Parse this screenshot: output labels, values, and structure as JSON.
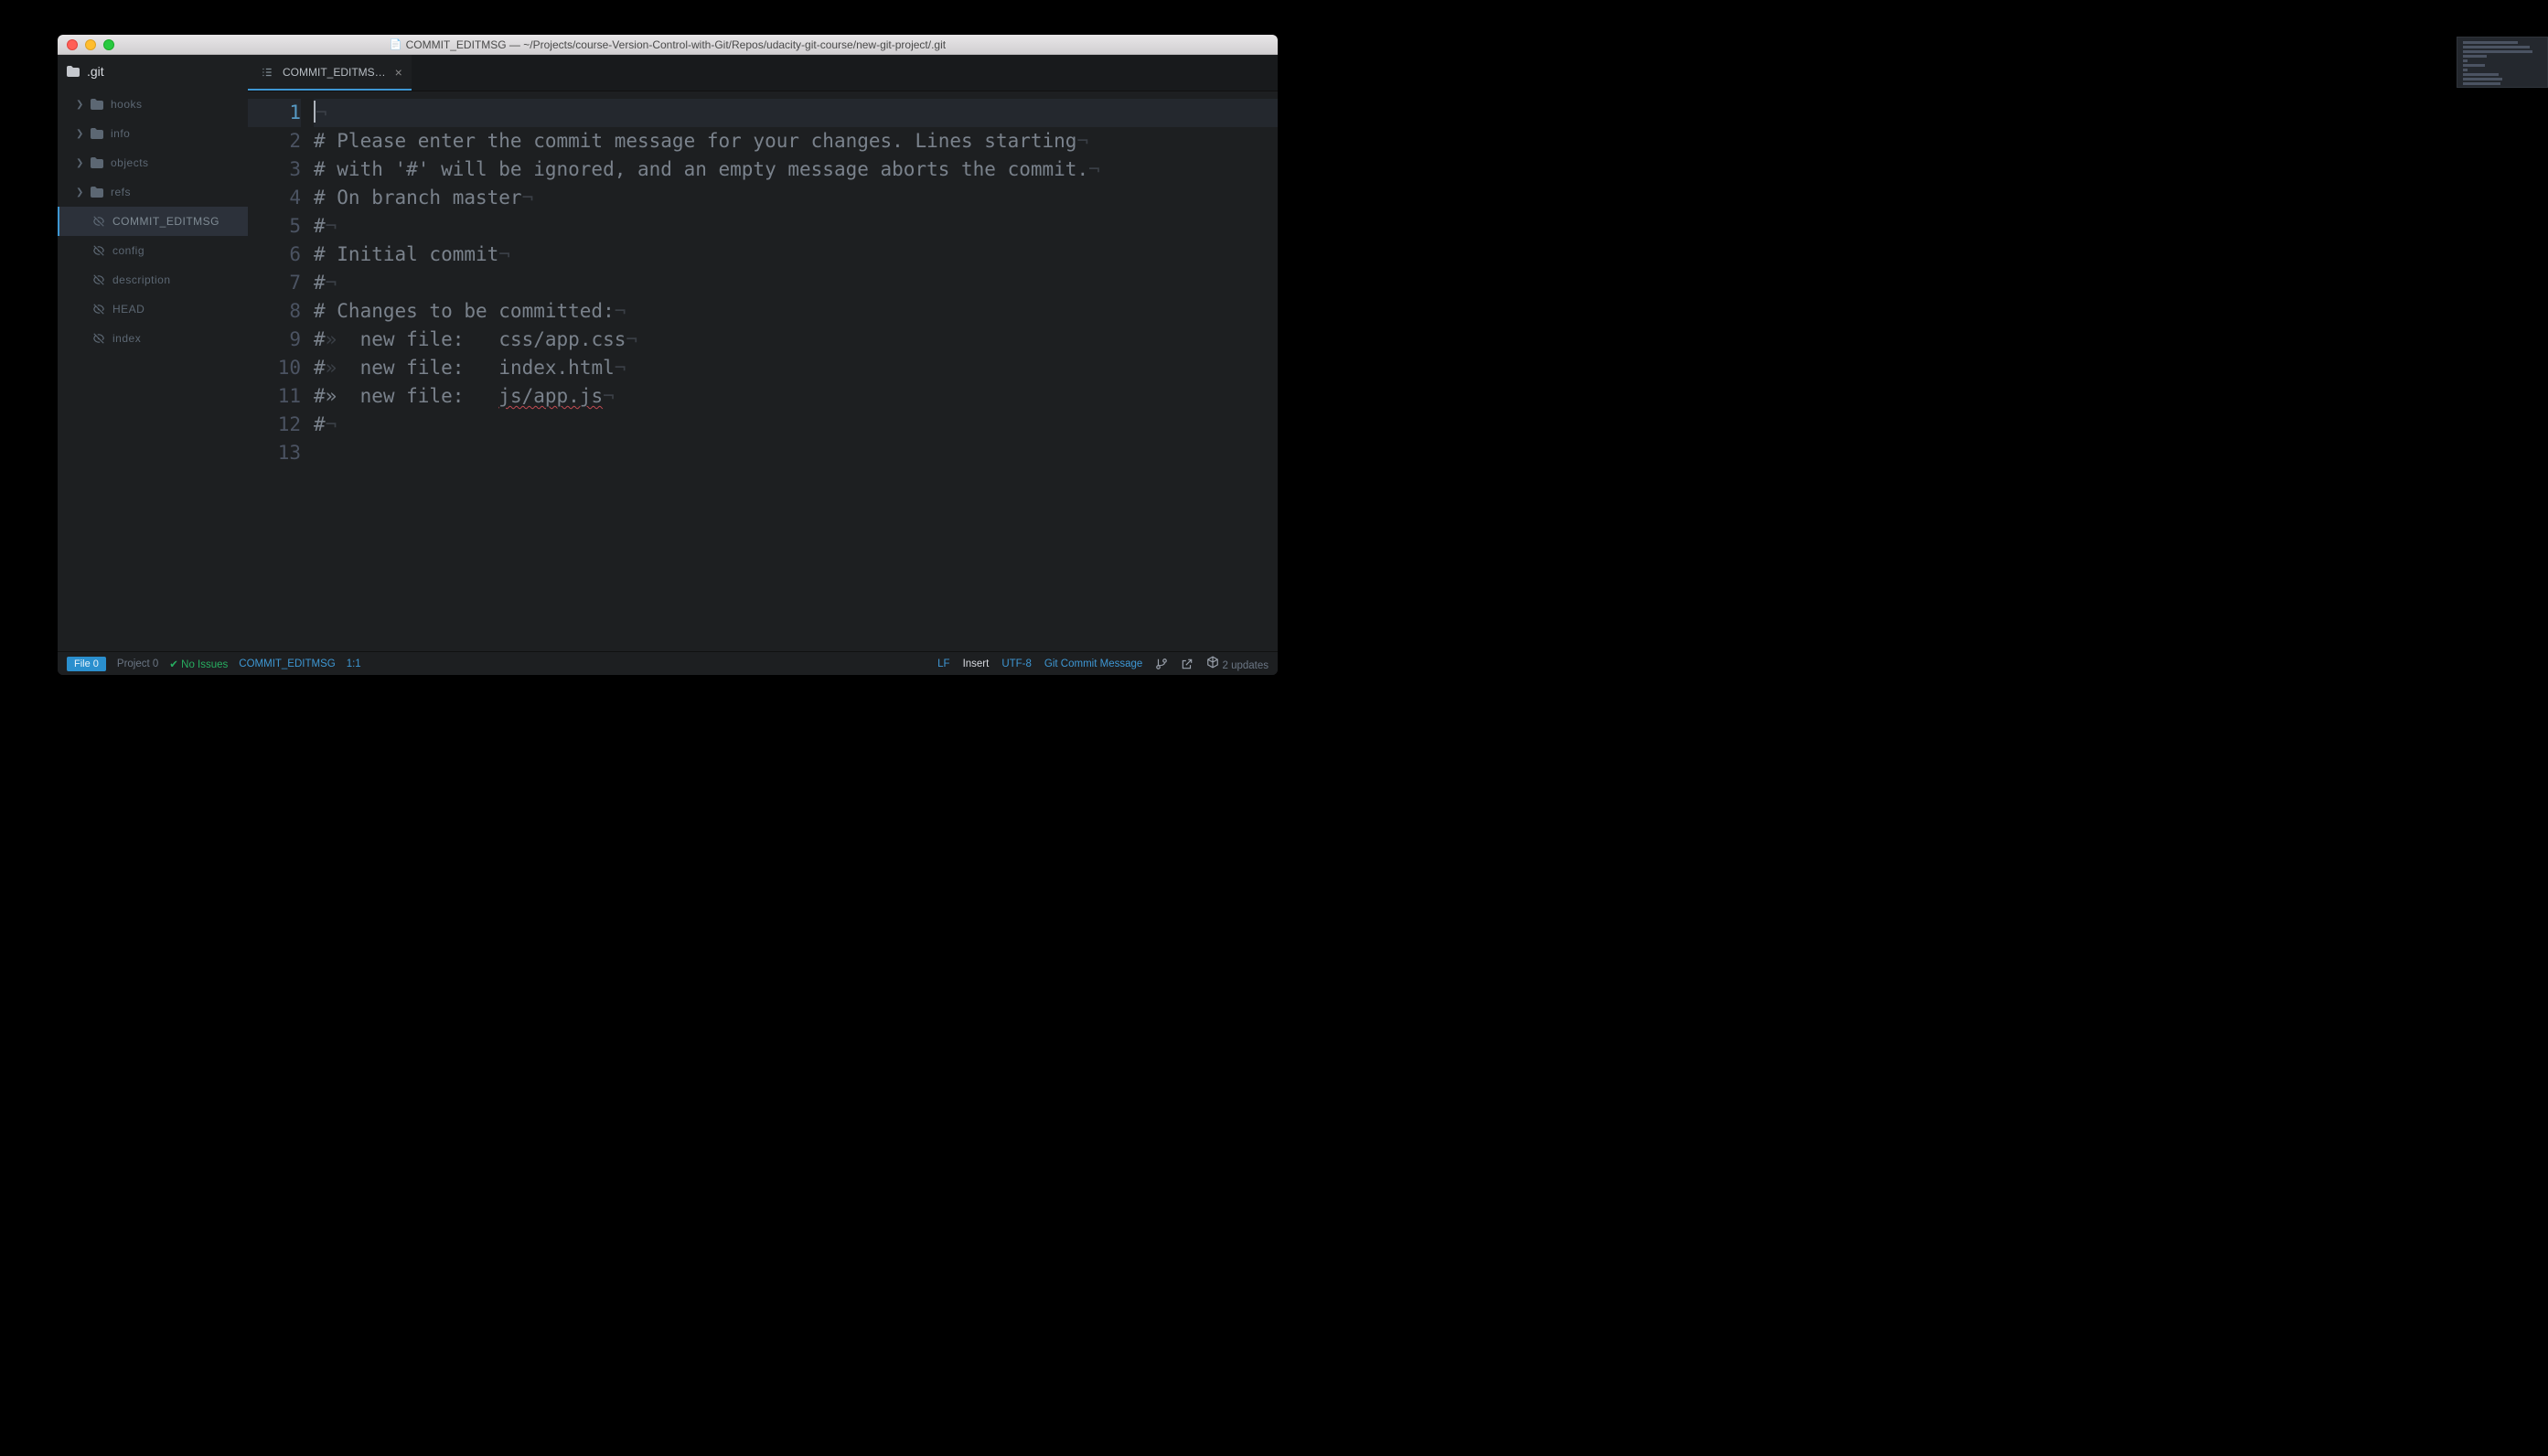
{
  "titlebar": {
    "title": "COMMIT_EDITMSG — ~/Projects/course-Version-Control-with-Git/Repos/udacity-git-course/new-git-project/.git"
  },
  "sidebar": {
    "root": ".git",
    "folders": [
      {
        "label": "hooks"
      },
      {
        "label": "info"
      },
      {
        "label": "objects"
      },
      {
        "label": "refs"
      }
    ],
    "files": [
      {
        "label": "COMMIT_EDITMSG",
        "selected": true
      },
      {
        "label": "config"
      },
      {
        "label": "description"
      },
      {
        "label": "HEAD"
      },
      {
        "label": "index"
      }
    ]
  },
  "tab": {
    "label": "COMMIT_EDITMS…"
  },
  "code": {
    "lines": [
      "",
      "# Please enter the commit message for your changes. Lines starting",
      "# with '#' will be ignored, and an empty message aborts the commit.",
      "# On branch master",
      "#",
      "# Initial commit",
      "#",
      "# Changes to be committed:",
      "#»  new file:   css/app.css",
      "#»  new file:   index.html",
      "#»  new file:   js/app.js",
      "#",
      ""
    ],
    "squiggle_line_index": 10,
    "squiggle_text": "js/app.js"
  },
  "statusbar": {
    "file_pill": "File 0",
    "project": "Project 0",
    "issues": "No Issues",
    "filename": "COMMIT_EDITMSG",
    "position": "1:1",
    "line_ending": "LF",
    "mode": "Insert",
    "encoding": "UTF-8",
    "grammar": "Git Commit Message",
    "updates": "2 updates"
  }
}
